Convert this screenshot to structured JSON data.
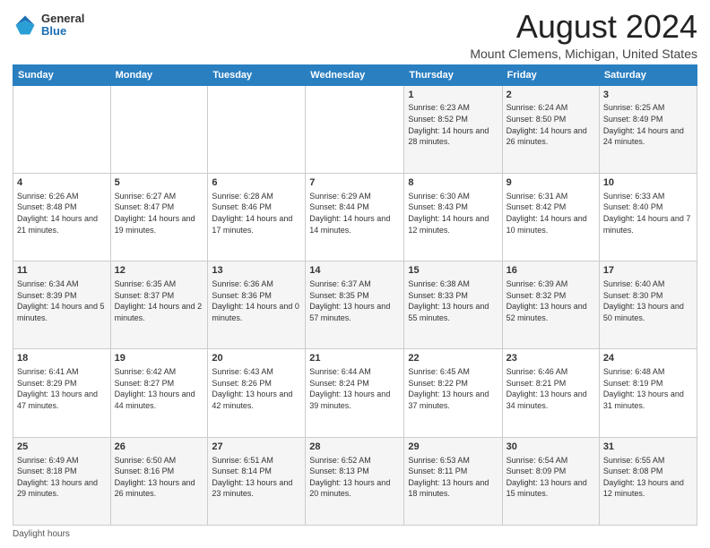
{
  "header": {
    "title": "August 2024",
    "subtitle": "Mount Clemens, Michigan, United States",
    "logo_general": "General",
    "logo_blue": "Blue"
  },
  "days_of_week": [
    "Sunday",
    "Monday",
    "Tuesday",
    "Wednesday",
    "Thursday",
    "Friday",
    "Saturday"
  ],
  "weeks": [
    [
      {
        "day": "",
        "info": ""
      },
      {
        "day": "",
        "info": ""
      },
      {
        "day": "",
        "info": ""
      },
      {
        "day": "",
        "info": ""
      },
      {
        "day": "1",
        "info": "Sunrise: 6:23 AM\nSunset: 8:52 PM\nDaylight: 14 hours and 28 minutes."
      },
      {
        "day": "2",
        "info": "Sunrise: 6:24 AM\nSunset: 8:50 PM\nDaylight: 14 hours and 26 minutes."
      },
      {
        "day": "3",
        "info": "Sunrise: 6:25 AM\nSunset: 8:49 PM\nDaylight: 14 hours and 24 minutes."
      }
    ],
    [
      {
        "day": "4",
        "info": "Sunrise: 6:26 AM\nSunset: 8:48 PM\nDaylight: 14 hours and 21 minutes."
      },
      {
        "day": "5",
        "info": "Sunrise: 6:27 AM\nSunset: 8:47 PM\nDaylight: 14 hours and 19 minutes."
      },
      {
        "day": "6",
        "info": "Sunrise: 6:28 AM\nSunset: 8:46 PM\nDaylight: 14 hours and 17 minutes."
      },
      {
        "day": "7",
        "info": "Sunrise: 6:29 AM\nSunset: 8:44 PM\nDaylight: 14 hours and 14 minutes."
      },
      {
        "day": "8",
        "info": "Sunrise: 6:30 AM\nSunset: 8:43 PM\nDaylight: 14 hours and 12 minutes."
      },
      {
        "day": "9",
        "info": "Sunrise: 6:31 AM\nSunset: 8:42 PM\nDaylight: 14 hours and 10 minutes."
      },
      {
        "day": "10",
        "info": "Sunrise: 6:33 AM\nSunset: 8:40 PM\nDaylight: 14 hours and 7 minutes."
      }
    ],
    [
      {
        "day": "11",
        "info": "Sunrise: 6:34 AM\nSunset: 8:39 PM\nDaylight: 14 hours and 5 minutes."
      },
      {
        "day": "12",
        "info": "Sunrise: 6:35 AM\nSunset: 8:37 PM\nDaylight: 14 hours and 2 minutes."
      },
      {
        "day": "13",
        "info": "Sunrise: 6:36 AM\nSunset: 8:36 PM\nDaylight: 14 hours and 0 minutes."
      },
      {
        "day": "14",
        "info": "Sunrise: 6:37 AM\nSunset: 8:35 PM\nDaylight: 13 hours and 57 minutes."
      },
      {
        "day": "15",
        "info": "Sunrise: 6:38 AM\nSunset: 8:33 PM\nDaylight: 13 hours and 55 minutes."
      },
      {
        "day": "16",
        "info": "Sunrise: 6:39 AM\nSunset: 8:32 PM\nDaylight: 13 hours and 52 minutes."
      },
      {
        "day": "17",
        "info": "Sunrise: 6:40 AM\nSunset: 8:30 PM\nDaylight: 13 hours and 50 minutes."
      }
    ],
    [
      {
        "day": "18",
        "info": "Sunrise: 6:41 AM\nSunset: 8:29 PM\nDaylight: 13 hours and 47 minutes."
      },
      {
        "day": "19",
        "info": "Sunrise: 6:42 AM\nSunset: 8:27 PM\nDaylight: 13 hours and 44 minutes."
      },
      {
        "day": "20",
        "info": "Sunrise: 6:43 AM\nSunset: 8:26 PM\nDaylight: 13 hours and 42 minutes."
      },
      {
        "day": "21",
        "info": "Sunrise: 6:44 AM\nSunset: 8:24 PM\nDaylight: 13 hours and 39 minutes."
      },
      {
        "day": "22",
        "info": "Sunrise: 6:45 AM\nSunset: 8:22 PM\nDaylight: 13 hours and 37 minutes."
      },
      {
        "day": "23",
        "info": "Sunrise: 6:46 AM\nSunset: 8:21 PM\nDaylight: 13 hours and 34 minutes."
      },
      {
        "day": "24",
        "info": "Sunrise: 6:48 AM\nSunset: 8:19 PM\nDaylight: 13 hours and 31 minutes."
      }
    ],
    [
      {
        "day": "25",
        "info": "Sunrise: 6:49 AM\nSunset: 8:18 PM\nDaylight: 13 hours and 29 minutes."
      },
      {
        "day": "26",
        "info": "Sunrise: 6:50 AM\nSunset: 8:16 PM\nDaylight: 13 hours and 26 minutes."
      },
      {
        "day": "27",
        "info": "Sunrise: 6:51 AM\nSunset: 8:14 PM\nDaylight: 13 hours and 23 minutes."
      },
      {
        "day": "28",
        "info": "Sunrise: 6:52 AM\nSunset: 8:13 PM\nDaylight: 13 hours and 20 minutes."
      },
      {
        "day": "29",
        "info": "Sunrise: 6:53 AM\nSunset: 8:11 PM\nDaylight: 13 hours and 18 minutes."
      },
      {
        "day": "30",
        "info": "Sunrise: 6:54 AM\nSunset: 8:09 PM\nDaylight: 13 hours and 15 minutes."
      },
      {
        "day": "31",
        "info": "Sunrise: 6:55 AM\nSunset: 8:08 PM\nDaylight: 13 hours and 12 minutes."
      }
    ]
  ],
  "footer": {
    "label": "Daylight hours"
  }
}
